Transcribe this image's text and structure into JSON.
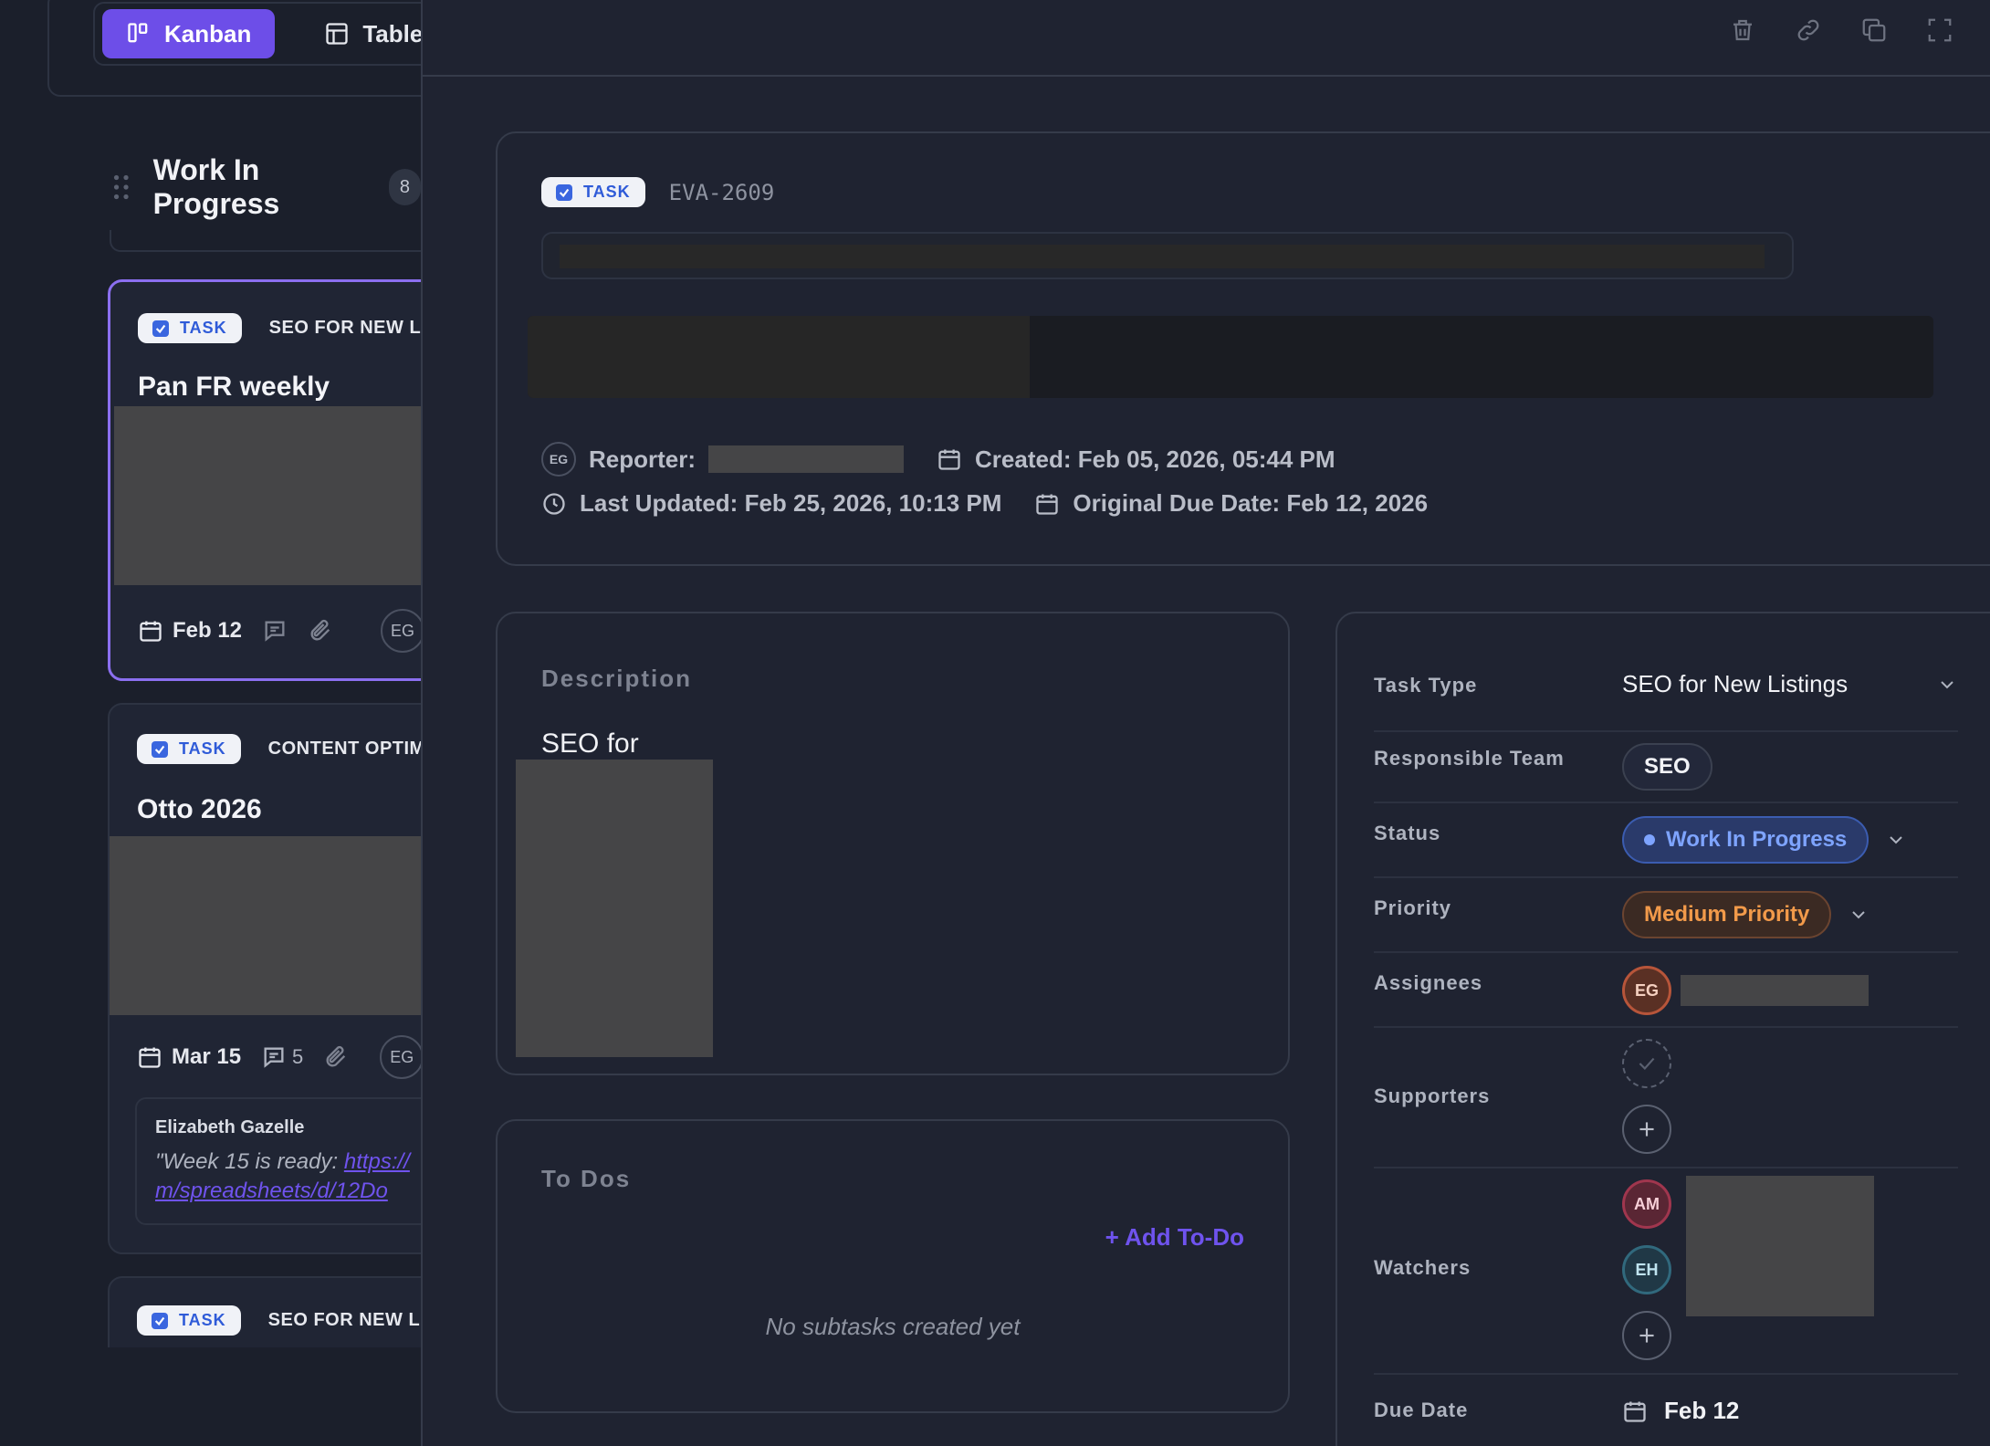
{
  "board": {
    "view_tabs": [
      {
        "label": "Kanban",
        "active": true,
        "icon": "kanban-icon"
      },
      {
        "label": "Table",
        "active": false,
        "icon": "table-icon"
      }
    ],
    "column": {
      "title": "Work In Progress",
      "count": "8"
    },
    "cards": [
      {
        "badge": "TASK",
        "category": "SEO FOR NEW LISTINGS",
        "title": "Pan FR weekly",
        "due": "Feb 12",
        "comments": "",
        "assignee": "EG"
      },
      {
        "badge": "TASK",
        "category": "CONTENT OPTIMIZATION",
        "title": "Otto 2026",
        "due": "Mar 15",
        "comments": "5",
        "assignee": "EG",
        "comment": {
          "author": "Elizabeth Gazelle",
          "text_prefix": "\"Week 15 is ready: ",
          "link_line1": "https://",
          "link_line2": "m/spreadsheets/d/12Do"
        }
      },
      {
        "badge": "TASK",
        "category": "SEO FOR NEW LISTINGS"
      }
    ]
  },
  "detail": {
    "badge": "TASK",
    "task_id": "EVA-2609",
    "reporter_label": "Reporter:",
    "reporter_initials": "EG",
    "created": "Created: Feb 05, 2026, 05:44 PM",
    "last_updated": "Last Updated: Feb 25, 2026, 10:13 PM",
    "original_due": "Original Due Date: Feb 12, 2026",
    "description_label": "Description",
    "description_text": "SEO for",
    "todos_label": "To Dos",
    "add_todo": "+ Add To-Do",
    "todos_empty": "No subtasks created yet",
    "props": {
      "task_type": {
        "label": "Task Type",
        "value": "SEO for New Listings"
      },
      "responsible_team": {
        "label": "Responsible Team",
        "value": "SEO"
      },
      "status": {
        "label": "Status",
        "value": "Work In Progress"
      },
      "priority": {
        "label": "Priority",
        "value": "Medium Priority"
      },
      "assignees": {
        "label": "Assignees",
        "initials": "EG"
      },
      "supporters": {
        "label": "Supporters"
      },
      "watchers": {
        "label": "Watchers",
        "initials": [
          "AM",
          "EH"
        ]
      },
      "due_date": {
        "label": "Due Date",
        "value": "Feb 12"
      }
    }
  },
  "colors": {
    "accent": "#6d4ee8",
    "status_blue": "#7ea4ff",
    "priority_orange": "#f29a4a"
  }
}
